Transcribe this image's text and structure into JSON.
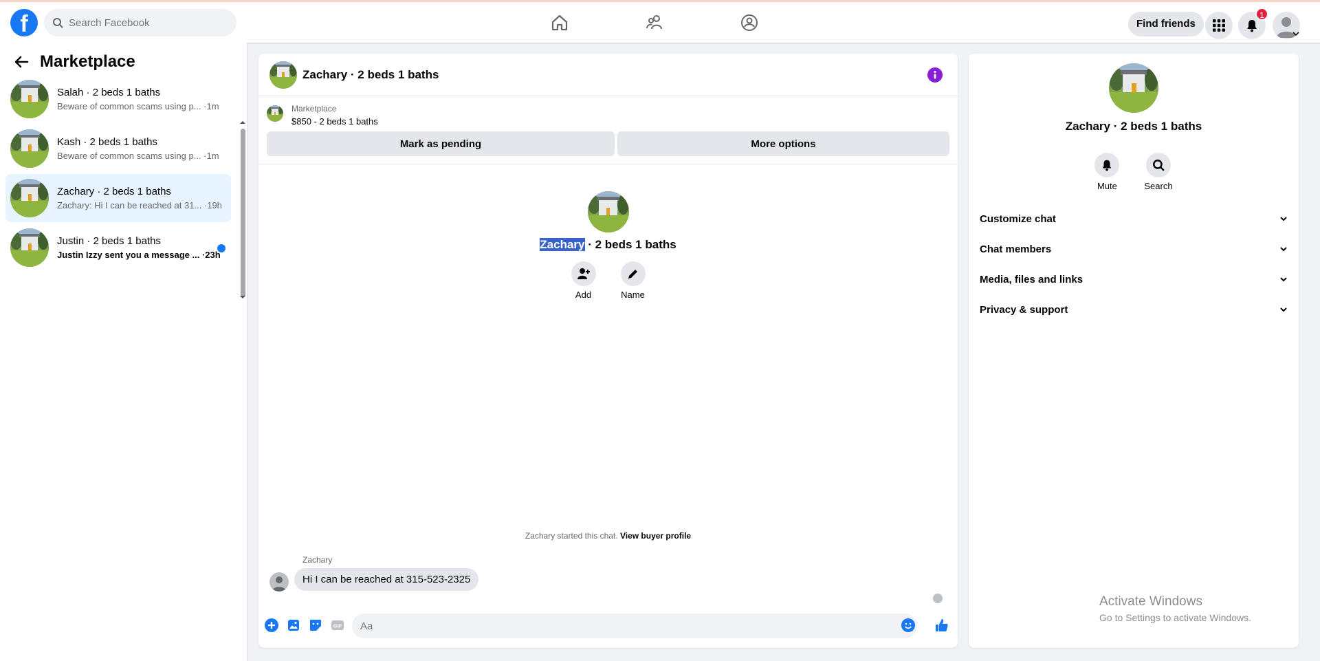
{
  "topbar": {
    "logo": "f",
    "search_placeholder": "Search Facebook",
    "find_friends": "Find friends",
    "notification_count": "1"
  },
  "sidebar": {
    "title": "Marketplace",
    "conversations": [
      {
        "name": "Salah · 2 beds 1 baths",
        "snippet": "Beware of common scams using p... ·1m",
        "unread": false
      },
      {
        "name": "Kash · 2 beds 1 baths",
        "snippet": "Beware of common scams using p... ·1m",
        "unread": false
      },
      {
        "name": "Zachary · 2 beds 1 baths",
        "snippet": "Zachary: Hi I can be reached at 31... ·19h",
        "unread": false
      },
      {
        "name": "Justin · 2 beds 1 baths",
        "snippet": "Justin Izzy sent you a message ... ·23h",
        "unread": true
      }
    ]
  },
  "chat": {
    "title": "Zachary · 2 beds 1 baths",
    "listing_source": "Marketplace",
    "listing_price": "$850 - 2 beds 1 baths",
    "mark_pending": "Mark as pending",
    "more_options": "More options",
    "intro_name_selected": "Zachary",
    "intro_name_rest": " · 2 beds 1 baths",
    "add_label": "Add",
    "name_label": "Name",
    "started_text": "Zachary started this chat.",
    "view_buyer_profile": "View buyer profile",
    "message_sender": "Zachary",
    "message_text": "Hi I can be reached at 315-523-2325",
    "composer_placeholder": "Aa"
  },
  "right_panel": {
    "name": "Zachary · 2 beds 1 baths",
    "mute": "Mute",
    "search": "Search",
    "sections": [
      "Customize chat",
      "Chat members",
      "Media, files and links",
      "Privacy & support"
    ]
  },
  "watermark": {
    "line1": "Activate Windows",
    "line2": "Go to Settings to activate Windows."
  },
  "colors": {
    "brand": "#1877f2",
    "info": "#8a1dd8",
    "badge": "#e41e3f"
  }
}
